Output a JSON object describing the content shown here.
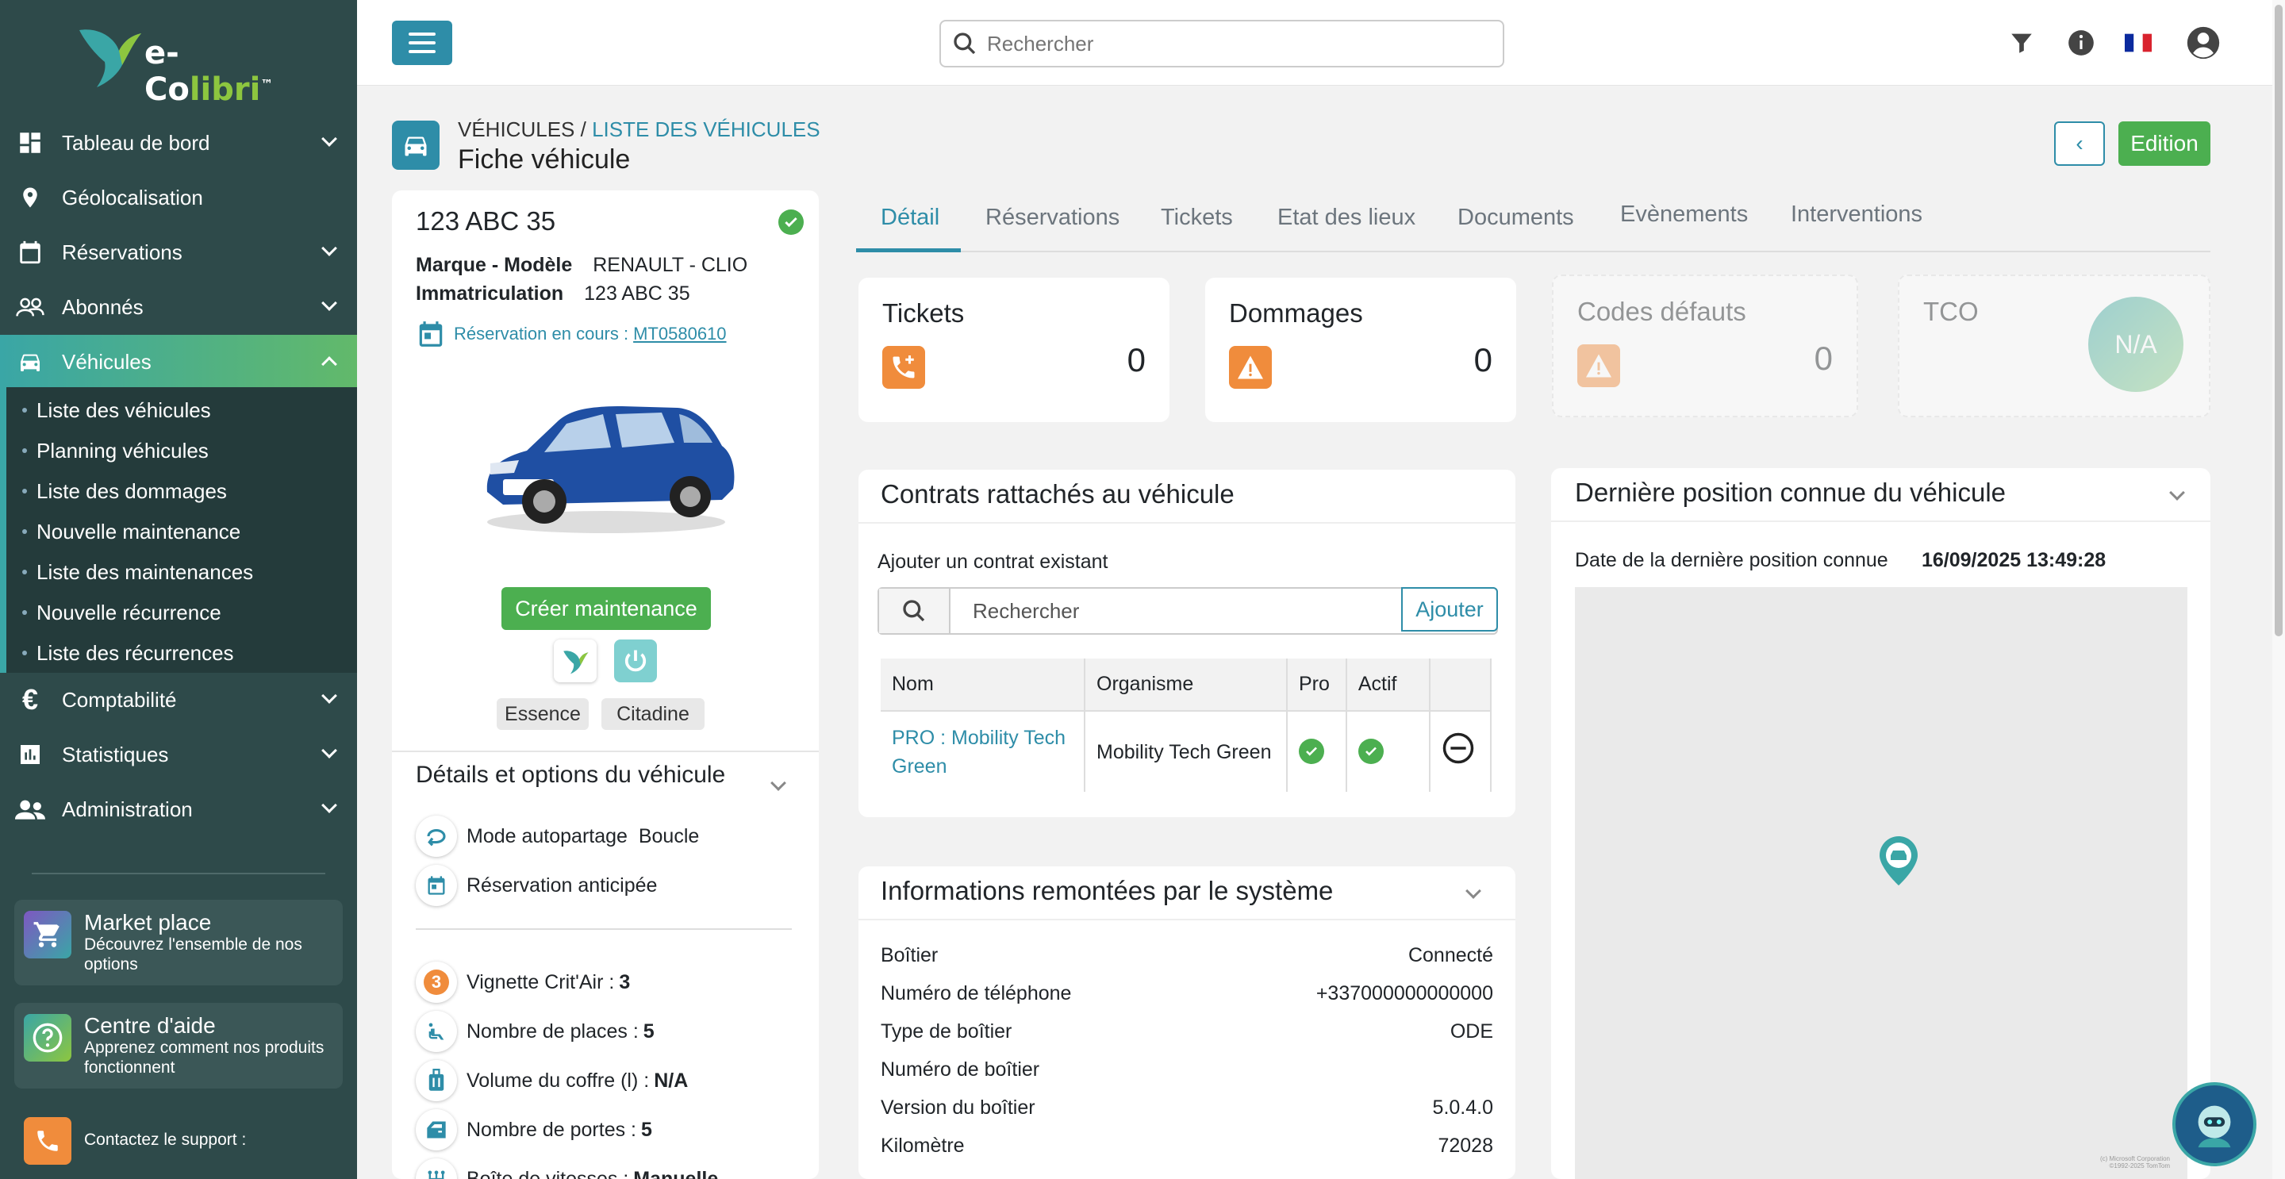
{
  "brand": {
    "name_a": "e-Co",
    "name_b": "libri",
    "tm": "™"
  },
  "sidebar": {
    "items": [
      {
        "label": "Tableau de bord"
      },
      {
        "label": "Géolocalisation"
      },
      {
        "label": "Réservations"
      },
      {
        "label": "Abonnés"
      },
      {
        "label": "Véhicules"
      },
      {
        "label": "Comptabilité"
      },
      {
        "label": "Statistiques"
      },
      {
        "label": "Administration"
      }
    ],
    "sub_items": [
      "Liste des véhicules",
      "Planning véhicules",
      "Liste des dommages",
      "Nouvelle maintenance",
      "Liste des maintenances",
      "Nouvelle récurrence",
      "Liste des récurrences"
    ],
    "market": {
      "title": "Market place",
      "desc": "Découvrez l'ensemble de nos options"
    },
    "help": {
      "title": "Centre d'aide",
      "desc": "Apprenez comment nos produits fonctionnent"
    },
    "support": {
      "label": "Contactez le support :"
    }
  },
  "header": {
    "search_placeholder": "Rechercher"
  },
  "breadcrumb": {
    "root": "VÉHICULES",
    "sep": " / ",
    "link": "LISTE DES VÉHICULES",
    "title": "Fiche véhicule"
  },
  "actions": {
    "edit": "Edition",
    "back": "‹"
  },
  "vehicle": {
    "plate": "123 ABC 35",
    "brand_label": "Marque - Modèle",
    "brand_value": "RENAULT - CLIO",
    "immat_label": "Immatriculation",
    "immat_value": "123 ABC 35",
    "resa_label": "Réservation en cours :",
    "resa_value": "MT0580610",
    "create_maintenance": "Créer maintenance",
    "chips": [
      "Essence",
      "Citadine"
    ],
    "options_title": "Détails et options du véhicule",
    "opt_mode_label": "Mode autopartage",
    "opt_mode_value": "Boucle",
    "opt_anticipated": "Réservation anticipée",
    "critair_label": "Vignette Crit'Air :",
    "critair_value": "3",
    "places_label": "Nombre de places :",
    "places_value": "5",
    "coffre_label": "Volume du coffre (l) :",
    "coffre_value": "N/A",
    "portes_label": "Nombre de portes :",
    "portes_value": "5",
    "boite_label": "Boîte de vitesses :",
    "boite_value": "Manuelle"
  },
  "tabs": [
    "Détail",
    "Réservations",
    "Tickets",
    "Etat des lieux",
    "Documents",
    "Evènements",
    "Interventions"
  ],
  "stats": {
    "tickets": {
      "title": "Tickets",
      "value": "0"
    },
    "dommages": {
      "title": "Dommages",
      "value": "0"
    },
    "codes": {
      "title": "Codes défauts",
      "value": "0"
    },
    "tco": {
      "title": "TCO",
      "value": "N/A"
    }
  },
  "contrats": {
    "title": "Contrats rattachés au véhicule",
    "add_label": "Ajouter un contrat existant",
    "search_placeholder": "Rechercher",
    "add_button": "Ajouter",
    "headers": [
      "Nom",
      "Organisme",
      "Pro",
      "Actif",
      ""
    ],
    "row": {
      "nom": "PRO : Mobility Tech Green",
      "organisme": "Mobility Tech Green"
    }
  },
  "position": {
    "title": "Dernière position connue du véhicule",
    "date_label": "Date de la dernière position connue",
    "date_value": "16/09/2025 13:49:28",
    "map_credit": "(c) Microsoft Corporation ©1992-2025 TomTom"
  },
  "infos": {
    "title": "Informations remontées par le système",
    "rows": [
      {
        "label": "Boîtier",
        "value": "Connecté"
      },
      {
        "label": "Numéro de téléphone",
        "value": "+337000000000000"
      },
      {
        "label": "Type de boîtier",
        "value": "ODE"
      },
      {
        "label": "Numéro de boîtier",
        "value": ""
      },
      {
        "label": "Version du boîtier",
        "value": "5.0.4.0"
      },
      {
        "label": "Kilomètre",
        "value": "72028"
      }
    ]
  },
  "colors": {
    "primary": "#2e8da8",
    "success": "#4caf50",
    "sidebar": "#2e4a4a",
    "orange": "#f08c3c"
  }
}
